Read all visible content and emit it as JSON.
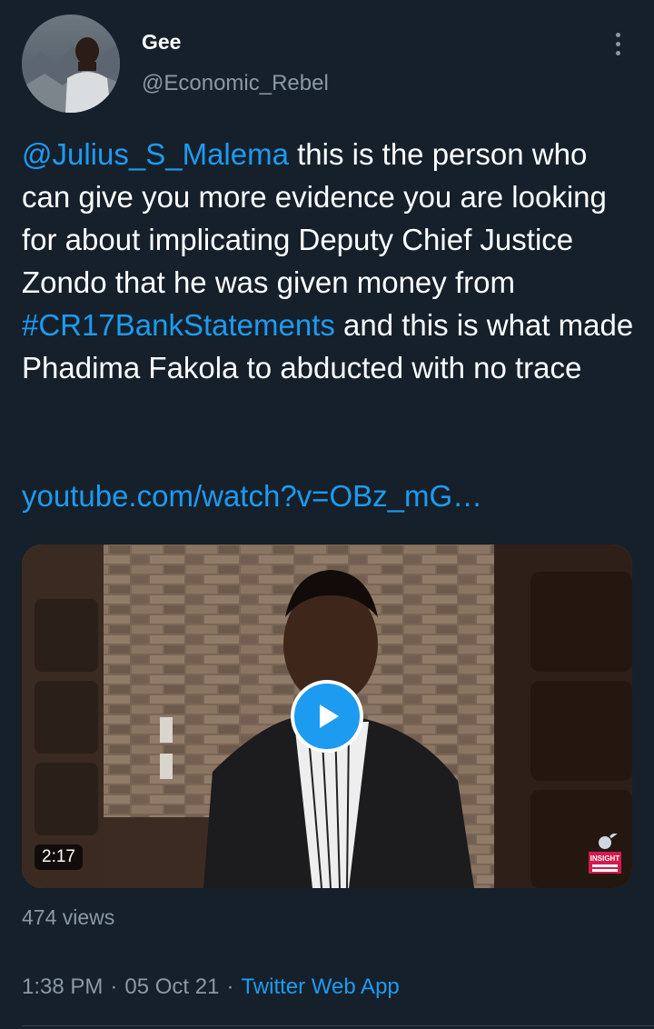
{
  "author": {
    "name": "Gee",
    "handle": "@Economic_Rebel",
    "avatar_icon": "profile-photo"
  },
  "tweet": {
    "mention": "@Julius_S_Malema",
    "text_part1": " this is the person who can give you more evidence you are looking for about implicating Deputy Chief Justice Zondo that he was given money from ",
    "hashtag": "#CR17BankStatements",
    "text_part2": " and this is what made Phadima Fakola to abducted with no trace",
    "link": "youtube.com/watch?v=OBz_mG…"
  },
  "video": {
    "duration": "2:17",
    "play_icon": "play-icon",
    "watermark_text": "INSIGHT"
  },
  "stats": {
    "views": "474 views"
  },
  "meta": {
    "time": "1:38 PM",
    "separator": "·",
    "date": "05 Oct 21",
    "source": "Twitter Web App"
  },
  "colors": {
    "background": "#15202b",
    "link": "#1d9bf0",
    "secondary_text": "#8b98a5"
  }
}
